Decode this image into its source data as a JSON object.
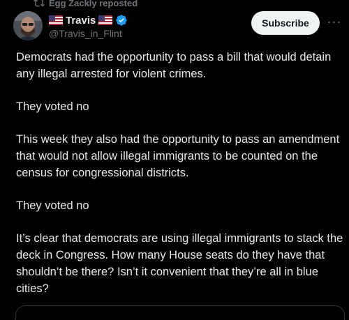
{
  "repost": {
    "text": "Egg Zackly reposted",
    "icon": "repost-icon"
  },
  "author": {
    "flag_left": "🇺🇸",
    "name": "Travis",
    "flag_right": "🇺🇸",
    "verified_icon": "verified-badge-icon",
    "handle": "@Travis_in_Flint",
    "avatar_icon": "avatar-photo"
  },
  "actions": {
    "subscribe_label": "Subscribe",
    "more_label": "···"
  },
  "post": {
    "paragraphs": [
      "Democrats had the opportunity to pass a bill that would detain any illegal arrested for violent crimes.",
      "They voted no",
      "This week they also had the opportunity to pass an amendment that would not allow illegal immigrants to be counted on the census for congressional districts.",
      "They voted no",
      "It’s clear that democrats are using illegal immigrants to stack the deck in Congress.  How many House seats do they have that shouldn’t be there?  Isn’t it convenient that they’re all in blue cities?"
    ]
  },
  "colors": {
    "background": "#000000",
    "text": "#e7e9ea",
    "secondary": "#71767b",
    "verified": "#1d9bf0",
    "subscribe_bg": "#eff3f4"
  }
}
